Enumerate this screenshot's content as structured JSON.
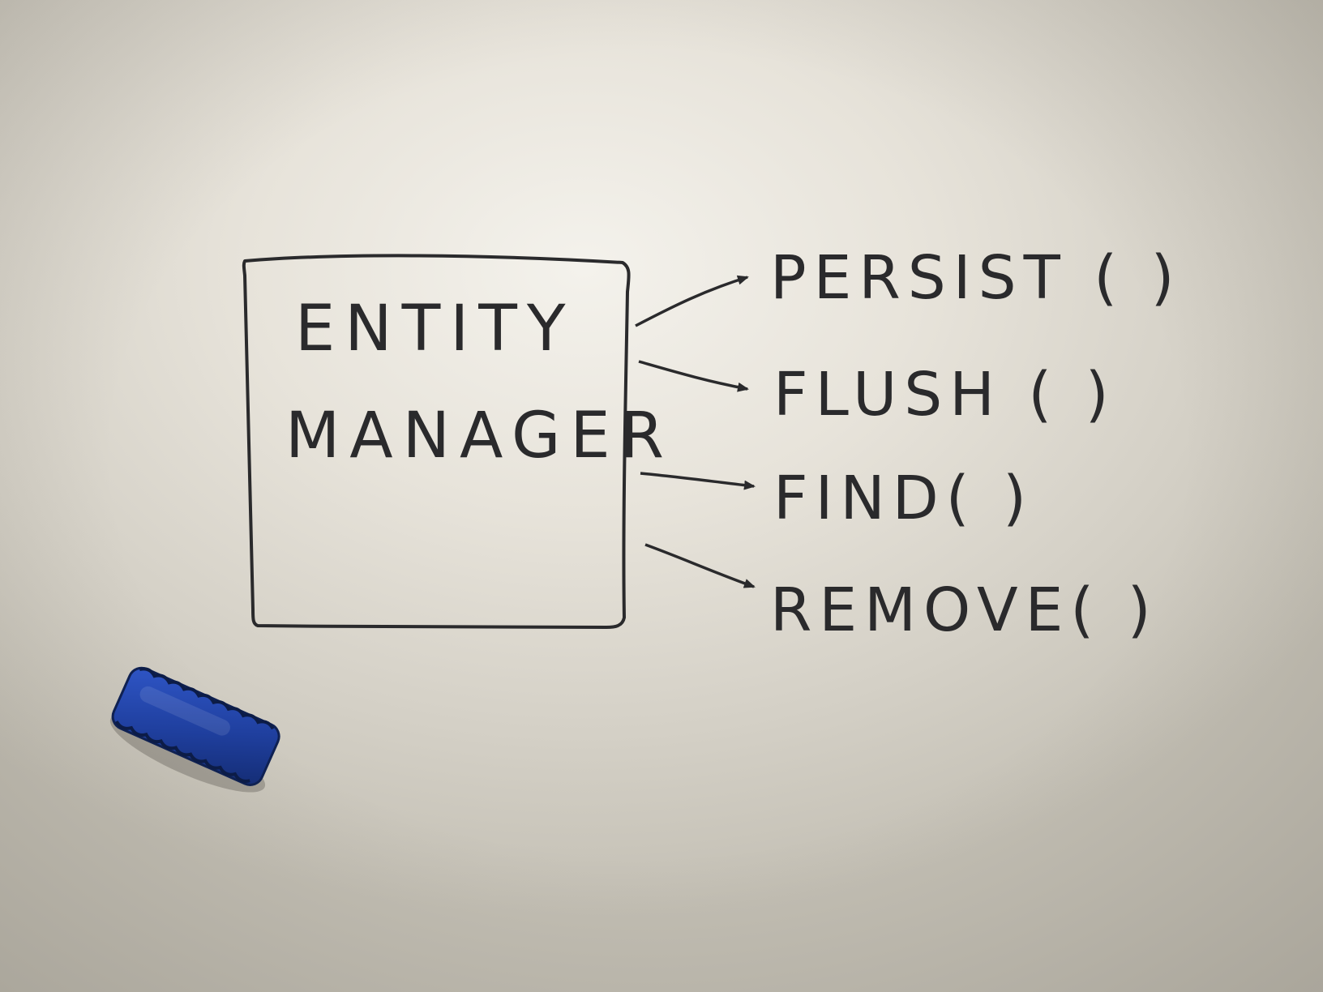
{
  "whiteboard": {
    "box": {
      "line1": "ENTITY",
      "line2": "MANAGER"
    },
    "methods": [
      {
        "label": "PERSIST ( )"
      },
      {
        "label": "FLUSH ( )"
      },
      {
        "label": "FIND( )"
      },
      {
        "label": "REMOVE( )"
      }
    ],
    "ink_color": "#2a2a2c",
    "eraser_color": "#1f3f9e"
  }
}
